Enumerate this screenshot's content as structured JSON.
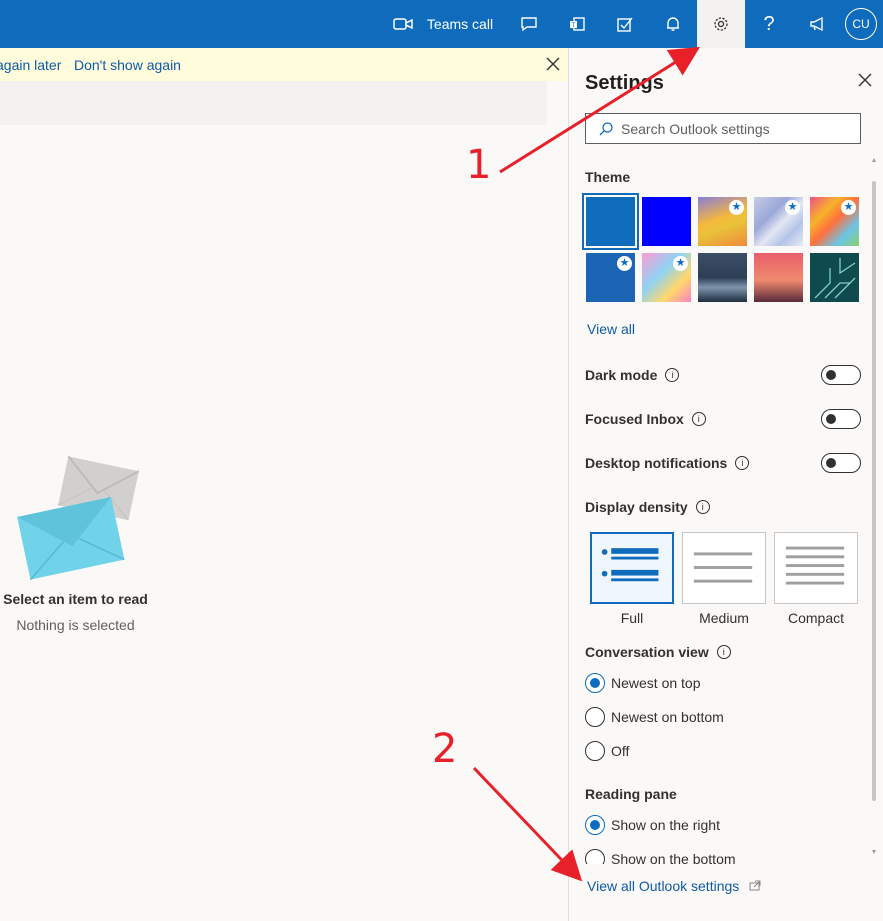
{
  "topbar": {
    "teams_call": "Teams call",
    "avatar_initials": "CU",
    "icons": [
      "video-icon",
      "chat-icon",
      "teams-icon",
      "tasks-icon",
      "bell-icon",
      "gear-icon",
      "help-icon",
      "megaphone-icon"
    ]
  },
  "notice": {
    "remind_later": "again later",
    "dont_show": "Don't show again"
  },
  "reading_pane": {
    "title": "Select an item to read",
    "subtitle": "Nothing is selected"
  },
  "settings": {
    "title": "Settings",
    "search_placeholder": "Search Outlook settings",
    "theme": {
      "label": "Theme",
      "view_all": "View all",
      "selected_index": 0
    },
    "toggles": [
      {
        "label": "Dark mode",
        "on": false
      },
      {
        "label": "Focused Inbox",
        "on": false
      },
      {
        "label": "Desktop notifications",
        "on": false
      }
    ],
    "display_density": {
      "label": "Display density",
      "options": [
        "Full",
        "Medium",
        "Compact"
      ],
      "selected": "Full"
    },
    "conversation_view": {
      "label": "Conversation view",
      "options": [
        "Newest on top",
        "Newest on bottom",
        "Off"
      ],
      "selected": "Newest on top"
    },
    "reading_pane": {
      "label": "Reading pane",
      "options": [
        "Show on the right",
        "Show on the bottom"
      ],
      "selected": "Show on the right"
    },
    "view_all_settings": "View all Outlook settings"
  },
  "annotations": {
    "step1": "1",
    "step2": "2",
    "color": "#e8202a"
  },
  "colors": {
    "brand": "#0f6cbd",
    "notice_bg": "#fffcdc",
    "link": "#0f5aa8"
  }
}
